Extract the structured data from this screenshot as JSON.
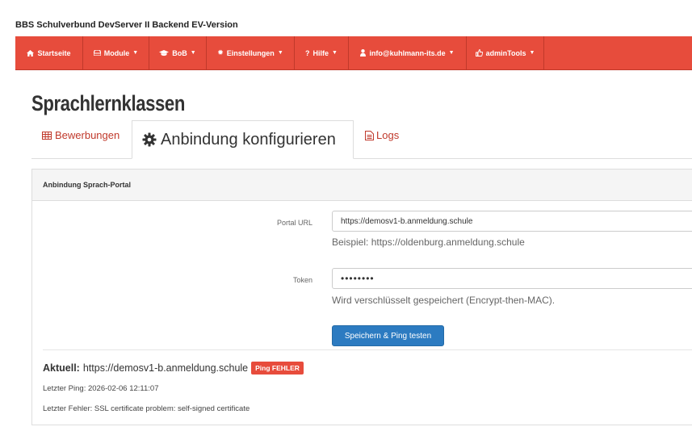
{
  "app": {
    "title": "BBS Schulverbund DevServer II Backend EV-Version"
  },
  "nav": {
    "items": [
      {
        "label": "Startseite",
        "icon": "home-icon",
        "caret": false
      },
      {
        "label": "Module",
        "icon": "hdd-icon",
        "caret": true
      },
      {
        "label": "BoB",
        "icon": "graduation-cap-icon",
        "caret": true
      },
      {
        "label": "Einstellungen",
        "icon": "cog-icon",
        "caret": true
      },
      {
        "label": "Hilfe",
        "icon": "question-icon",
        "caret": true
      },
      {
        "label": "info@kuhlmann-its.de",
        "icon": "user-icon",
        "caret": true
      },
      {
        "label": "adminTools",
        "icon": "thumbs-up-icon",
        "caret": true
      }
    ],
    "color": "#e74c3c"
  },
  "page": {
    "title": "Sprachlernklassen"
  },
  "tabs": [
    {
      "label": "Bewerbungen",
      "icon": "table-icon",
      "active": false
    },
    {
      "label": "Anbindung konfigurieren",
      "icon": "cog-icon",
      "active": true
    },
    {
      "label": "Logs",
      "icon": "file-text-icon",
      "active": false
    }
  ],
  "panel": {
    "heading": "Anbindung Sprach-Portal",
    "portal_url": {
      "label": "Portal URL",
      "value": "https://demosv1-b.anmeldung.schule",
      "help": "Beispiel: https://oldenburg.anmeldung.schule"
    },
    "token": {
      "label": "Token",
      "value": "••••••••",
      "help": "Wird verschlüsselt gespeichert (Encrypt-then-MAC)."
    },
    "save_button": "Speichern & Ping testen",
    "current": {
      "label": "Aktuell:",
      "value": "https://demosv1-b.anmeldung.schule",
      "badge": "Ping FEHLER"
    },
    "last_ping": "Letzter Ping: 2026-02-06 12:11:07",
    "last_error": "Letzter Fehler: SSL certificate problem: self-signed certificate"
  },
  "colors": {
    "accent": "#e74c3c",
    "primary": "#2c7bc1",
    "link": "#c0392b"
  }
}
